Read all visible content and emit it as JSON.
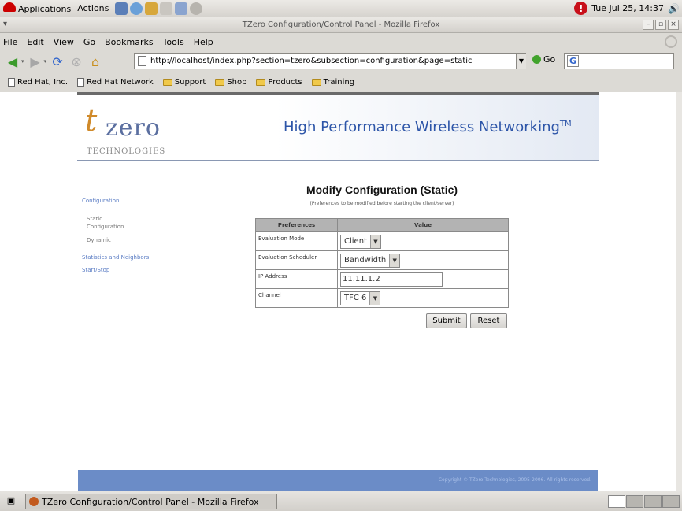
{
  "panel": {
    "applications": "Applications",
    "actions": "Actions",
    "clock": "Tue Jul 25, 14:37"
  },
  "window": {
    "title": "TZero Configuration/Control Panel - Mozilla Firefox"
  },
  "menubar": {
    "file": "File",
    "edit": "Edit",
    "view": "View",
    "go": "Go",
    "bookmarks": "Bookmarks",
    "tools": "Tools",
    "help": "Help"
  },
  "navbar": {
    "url": "http://localhost/index.php?section=tzero&subsection=configuration&page=static",
    "go_label": "Go",
    "search_value": ""
  },
  "bookmarks_bar": [
    {
      "label": "Red Hat, Inc.",
      "type": "doc"
    },
    {
      "label": "Red Hat Network",
      "type": "doc"
    },
    {
      "label": "Support",
      "type": "folder"
    },
    {
      "label": "Shop",
      "type": "folder"
    },
    {
      "label": "Products",
      "type": "folder"
    },
    {
      "label": "Training",
      "type": "folder"
    }
  ],
  "banner": {
    "logo_t": "t",
    "logo_zero": "zero",
    "logo_tech": "TECHNOLOGIES",
    "tagline": "High Performance Wireless Networking",
    "tm": "TM"
  },
  "sidenav": {
    "configuration": "Configuration",
    "static_line1": "Static",
    "static_line2": "Configuration",
    "dynamic": "Dynamic",
    "statistics": "Statistics and Neighbors",
    "startstop": "Start/Stop"
  },
  "page": {
    "heading": "Modify Configuration (Static)",
    "subheading": "(Preferences to be modified before starting the client/server)"
  },
  "table": {
    "col_preferences": "Preferences",
    "col_value": "Value",
    "rows": [
      {
        "pref": "Evaluation Mode",
        "value": "Client",
        "type": "select"
      },
      {
        "pref": "Evaluation Scheduler",
        "value": "Bandwidth",
        "type": "select"
      },
      {
        "pref": "IP Address",
        "value": "11.11.1.2",
        "type": "input"
      },
      {
        "pref": "Channel",
        "value": "TFC 6",
        "type": "select"
      }
    ]
  },
  "buttons": {
    "submit": "Submit",
    "reset": "Reset"
  },
  "footer": {
    "copyright": "Copyright © TZero Technologies, 2005-2006. All rights reserved."
  },
  "taskbar": {
    "task_label": "TZero Configuration/Control Panel - Mozilla Firefox"
  }
}
